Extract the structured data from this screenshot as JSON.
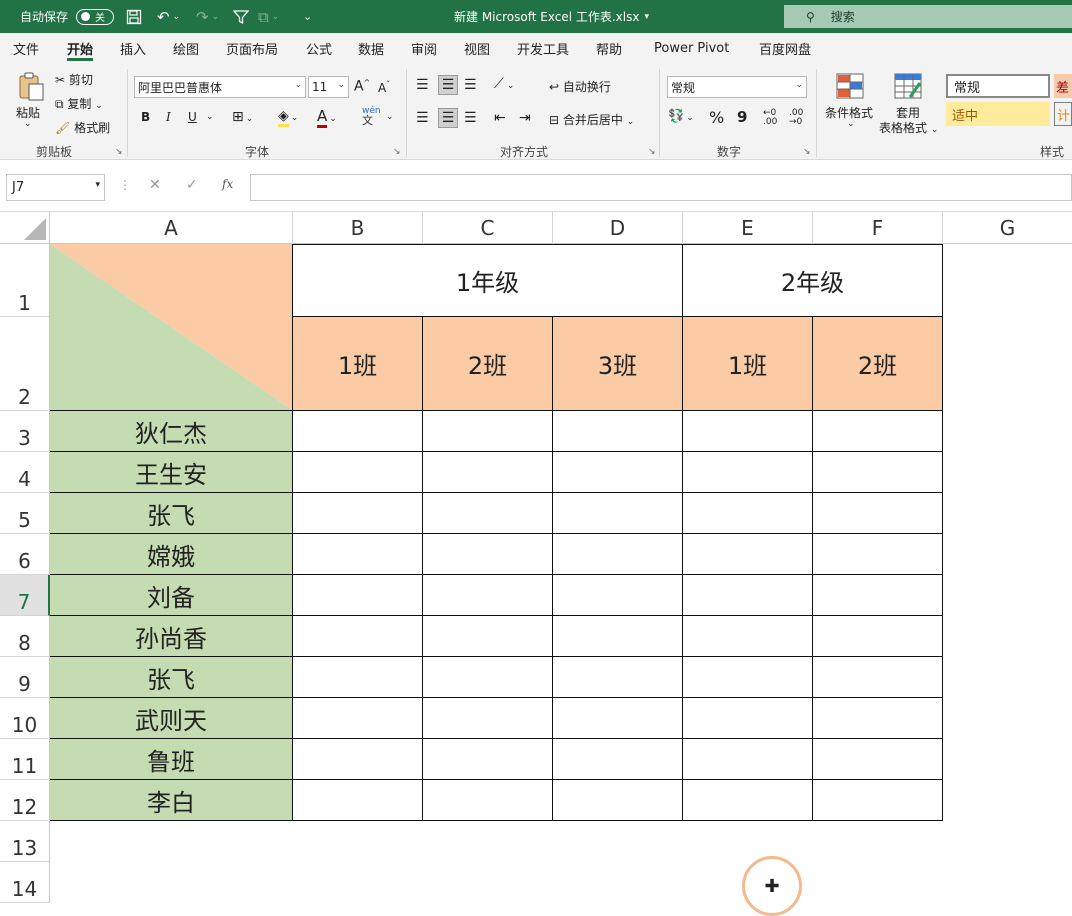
{
  "titlebar": {
    "autosave_label": "自动保存",
    "autosave_state": "关",
    "file_title": "新建 Microsoft Excel 工作表.xlsx",
    "search_placeholder": "搜索"
  },
  "menu_tabs": [
    "文件",
    "开始",
    "插入",
    "绘图",
    "页面布局",
    "公式",
    "数据",
    "审阅",
    "视图",
    "开发工具",
    "帮助",
    "Power Pivot",
    "百度网盘"
  ],
  "ribbon": {
    "clipboard": {
      "paste": "粘贴",
      "cut": "剪切",
      "copy": "复制",
      "format_painter": "格式刷",
      "label": "剪贴板"
    },
    "font": {
      "name": "阿里巴巴普惠体",
      "size": "11",
      "bold": "B",
      "italic": "I",
      "underline": "U",
      "label": "字体"
    },
    "alignment": {
      "wrap": "自动换行",
      "merge": "合并后居中",
      "label": "对齐方式"
    },
    "number": {
      "format": "常规",
      "percent": "%",
      "comma": "9",
      "label": "数字"
    },
    "styles": {
      "conditional": "条件格式",
      "table_line1": "套用",
      "table_line2": "表格格式",
      "normal": "常规",
      "neutral": "适中",
      "bad": "差",
      "calc": "计",
      "label": "样式"
    }
  },
  "formula_bar": {
    "name_box": "J7",
    "fx": "fx",
    "content": ""
  },
  "columns": [
    "A",
    "B",
    "C",
    "D",
    "E",
    "F",
    "G"
  ],
  "rows": [
    "1",
    "2",
    "3",
    "4",
    "5",
    "6",
    "7",
    "8",
    "9",
    "10",
    "11",
    "12",
    "13",
    "14"
  ],
  "selected_row": "7",
  "sheet": {
    "grade1": "1年级",
    "grade2": "2年级",
    "classes": [
      "1班",
      "2班",
      "3班",
      "1班",
      "2班"
    ],
    "names": [
      "狄仁杰",
      "王生安",
      "张飞",
      "嫦娥",
      "刘备",
      "孙尚香",
      "张飞",
      "武则天",
      "鲁班",
      "李白"
    ]
  },
  "colors": {
    "accent": "#217346",
    "header_fill": "#fbcba6",
    "name_fill": "#c5dcb2",
    "cursor_ring": "#f4b98c"
  }
}
